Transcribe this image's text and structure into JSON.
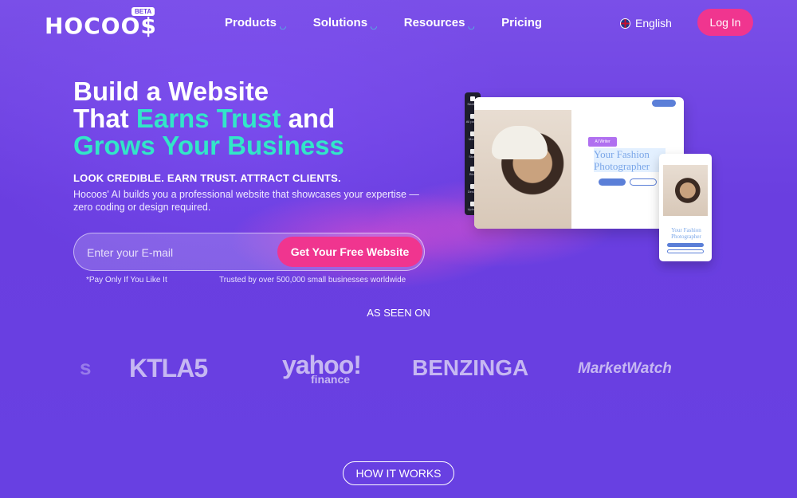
{
  "brand": {
    "logo": "HOCOO$",
    "badge": "BETA"
  },
  "nav": {
    "items": [
      {
        "label": "Products",
        "has_dropdown": true
      },
      {
        "label": "Solutions",
        "has_dropdown": true
      },
      {
        "label": "Resources",
        "has_dropdown": true
      },
      {
        "label": "Pricing",
        "has_dropdown": false
      }
    ],
    "language": "English",
    "login": "Log In"
  },
  "hero": {
    "line1": "Build a Website",
    "line2_plain": "That ",
    "line2_accent": "Earns Trust",
    "line2_tail": " and",
    "line3_accent": "Grows Your Business",
    "subhead": "LOOK CREDIBLE. EARN TRUST. ATTRACT CLIENTS.",
    "description": "Hocoos' AI builds you a professional website that showcases your expertise — zero coding or design required."
  },
  "signup": {
    "placeholder": "Enter your E-mail",
    "cta": "Get Your Free Website",
    "note_left": "*Pay Only If You Like It",
    "note_right": "Trusted by over 500,000 small businesses worldwide"
  },
  "mockup": {
    "toolbar": [
      "Section",
      "All pages",
      "Menu",
      "Store",
      "Blog",
      "Design",
      "Upload"
    ],
    "ai_chip": "AI Writer",
    "site_title": "Your Fashion Photographer",
    "phone_title": "Your Fashion Photographer"
  },
  "press": {
    "heading": "AS SEEN ON",
    "logos": [
      "s",
      "KTLA5",
      "yahoo!",
      "finance",
      "BENZINGA",
      "MarketWatch"
    ]
  },
  "how_it_works": "HOW IT WORKS",
  "colors": {
    "background": "#6a3ee0",
    "accent_pink": "#f0358f",
    "accent_teal": "#32e6c8"
  }
}
